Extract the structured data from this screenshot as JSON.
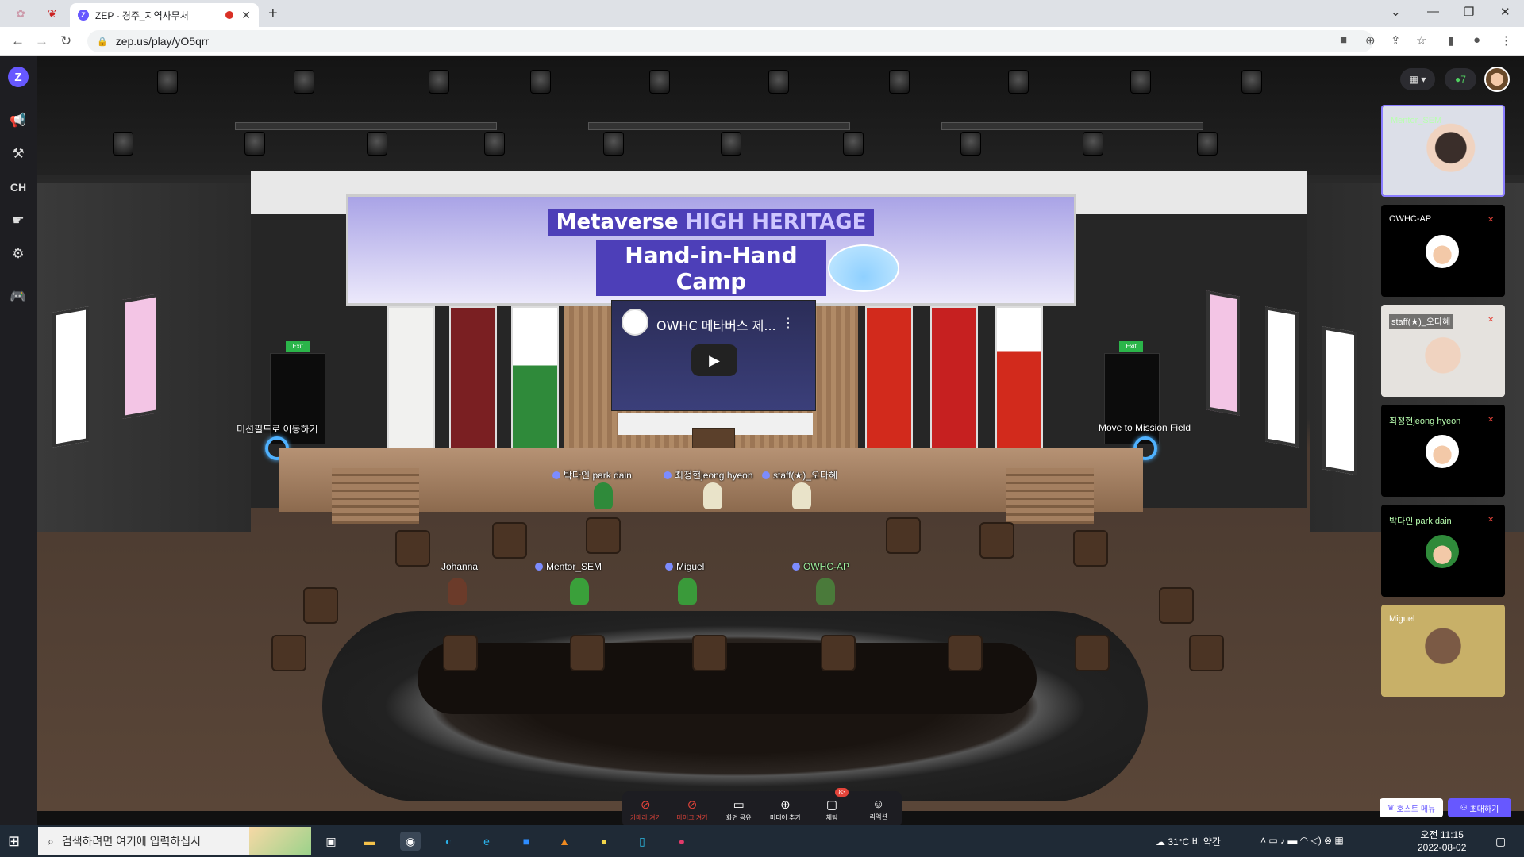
{
  "browser": {
    "tab_title": "ZEP - 경주_지역사무처",
    "url": "zep.us/play/yO5qrr"
  },
  "sidebar": {
    "logo": "Z",
    "items": [
      {
        "icon": "megaphone-icon"
      },
      {
        "icon": "hammer-icon"
      },
      {
        "label": "CH"
      },
      {
        "icon": "emote-icon"
      },
      {
        "icon": "gear-icon"
      },
      {
        "icon": "gamepad-icon"
      }
    ]
  },
  "header": {
    "online_count": "7"
  },
  "map": {
    "banner_line1_a": "Metaverse",
    "banner_line1_b": "HIGH HERITAGE",
    "banner_line2": "Hand-in-Hand Camp",
    "video_title": "OWHC 메타버스 제...",
    "portal_left": "미션필드로 이동하기",
    "portal_right": "Move to Mission Field",
    "exit_label": "Exit"
  },
  "players": [
    {
      "name": "박다인 park dain",
      "color": "#2f8a3a"
    },
    {
      "name": "최정현jeong hyeon",
      "color": "#e9e3c9"
    },
    {
      "name": "staff(★)_오다혜",
      "color": "#e9e3c9"
    },
    {
      "name": "Johanna",
      "color": "#6b3b2a"
    },
    {
      "name": "Mentor_SEM",
      "color": "#3aa03a"
    },
    {
      "name": "Miguel",
      "color": "#3a9a3a"
    },
    {
      "name": "OWHC-AP",
      "color": "#4a7a3a"
    }
  ],
  "video_tiles": [
    {
      "name": "Mentor_SEM",
      "type": "camera"
    },
    {
      "name": "OWHC-AP",
      "type": "avatar"
    },
    {
      "name": "staff(★)_오다혜",
      "type": "camera"
    },
    {
      "name": "최정현jeong hyeon",
      "type": "avatar"
    },
    {
      "name": "박다인 park dain",
      "type": "avatar"
    },
    {
      "name": "Miguel",
      "type": "camera"
    }
  ],
  "controls": [
    {
      "label": "카메라 켜기",
      "icon": "camera-off-icon",
      "off": true
    },
    {
      "label": "마이크 켜기",
      "icon": "mic-off-icon",
      "off": true
    },
    {
      "label": "화면 공유",
      "icon": "screen-share-icon",
      "off": false
    },
    {
      "label": "미디어 추가",
      "icon": "media-add-icon",
      "off": false
    },
    {
      "label": "채팅",
      "icon": "chat-icon",
      "off": false,
      "badge": "83"
    },
    {
      "label": "리액션",
      "icon": "reaction-icon",
      "off": false
    }
  ],
  "host_menu": "호스트 메뉴",
  "invite": "초대하기",
  "taskbar": {
    "search_placeholder": "검색하려면 여기에 입력하십시",
    "weather": "31°C 비 약간",
    "time": "오전 11:15",
    "date": "2022-08-02"
  }
}
